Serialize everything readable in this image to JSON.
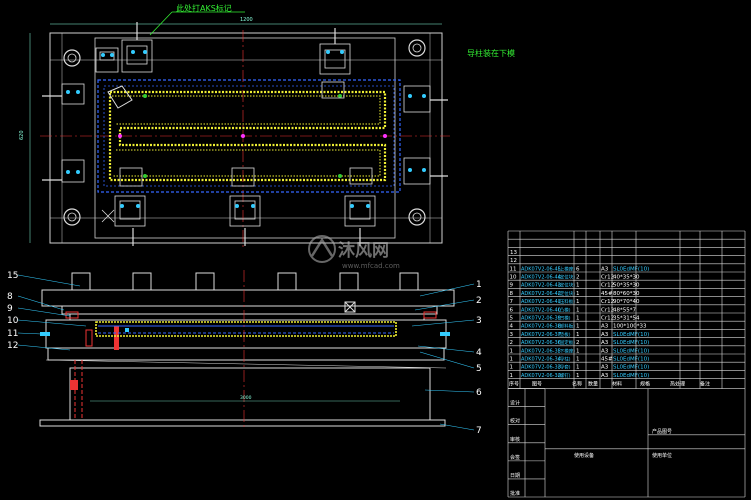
{
  "annotations": {
    "aks_note": "此处打AKS标记",
    "guide_note": "导柱装在下模",
    "top_width": "1200",
    "top_height": "620",
    "bottom_width": "3000"
  },
  "balloons": [
    "15",
    "8",
    "9",
    "10",
    "11",
    "12",
    "1",
    "2",
    "3",
    "4",
    "5",
    "6",
    "7"
  ],
  "watermark": {
    "brand": "沐风网",
    "url": "www.mfcad.com"
  },
  "title_block": {
    "top_rows": [
      "",
      "",
      "13",
      "12"
    ],
    "rows": [
      {
        "no": "11",
        "code": "ADK07V2-06-45",
        "name": "(上模座)",
        "qty": "6",
        "mat": "A3",
        "spec": "SL0EdMF(10)"
      },
      {
        "no": "10",
        "code": "ADK07V2-06-44",
        "name": "(定位块)",
        "qty": "2",
        "mat": "Cr12",
        "spec": "40*35*30"
      },
      {
        "no": "9",
        "code": "ADK07V2-06-43",
        "name": "(定位块)",
        "qty": "1",
        "mat": "Cr12",
        "spec": "50*35*30"
      },
      {
        "no": "8",
        "code": "ADK07V2-06-42",
        "name": "(定位块)",
        "qty": "1",
        "mat": "45#",
        "spec": "80*60*30"
      },
      {
        "no": "7",
        "code": "ADK07V2-06-41",
        "name": "(压料板)",
        "qty": "1",
        "mat": "Cr12",
        "spec": "90*70*40"
      },
      {
        "no": "6",
        "code": "ADK07V2-06-40",
        "name": "(凸模)",
        "qty": "1",
        "mat": "Cr12",
        "spec": "48*55*7"
      },
      {
        "no": "5",
        "code": "ADK07V2-06-39",
        "name": "(凹模)",
        "qty": "1",
        "mat": "Cr12",
        "spec": "35*31*54"
      },
      {
        "no": "4",
        "code": "ADK07V2-06-38",
        "name": "(卸料板)",
        "qty": "1",
        "mat": "A3",
        "spec": "100*100*33"
      },
      {
        "no": "3",
        "code": "ADK07V2-06-37",
        "name": "(垫板)",
        "qty": "1",
        "mat": "A3",
        "spec": "SL0EdMF(10)"
      },
      {
        "no": "2",
        "code": "ADK07V2-06-36",
        "name": "(固定板)",
        "qty": "2",
        "mat": "A3",
        "spec": "SL0EdMF(10)"
      },
      {
        "no": "1",
        "code": "ADK07V2-06-35",
        "name": "(下模座)",
        "qty": "1",
        "mat": "A3",
        "spec": "SL0EdMF(10)"
      },
      {
        "no": "1",
        "code": "ADK07V2-06-34",
        "name": "(导柱)",
        "qty": "1",
        "mat": "45#",
        "spec": "SL0EdMF(10)"
      },
      {
        "no": "1",
        "code": "ADK07V2-06-33",
        "name": "(导套)",
        "qty": "1",
        "mat": "A3",
        "spec": "SL0EdMF(10)"
      },
      {
        "no": "1",
        "code": "ADK07V2-06-32",
        "name": "(螺钉)",
        "qty": "1",
        "mat": "A3",
        "spec": "SL0EdMF(10)"
      }
    ],
    "header": [
      "序号",
      "图号",
      "名称",
      "数量",
      "材料",
      "规格",
      "热处理",
      "备注"
    ],
    "sign_labels": [
      "设计",
      "校对",
      "审核",
      "会签",
      "日期",
      "批准"
    ],
    "product_name_label": "产品图号",
    "equipment_label": "使用设备",
    "unit_label": "使用单位"
  }
}
